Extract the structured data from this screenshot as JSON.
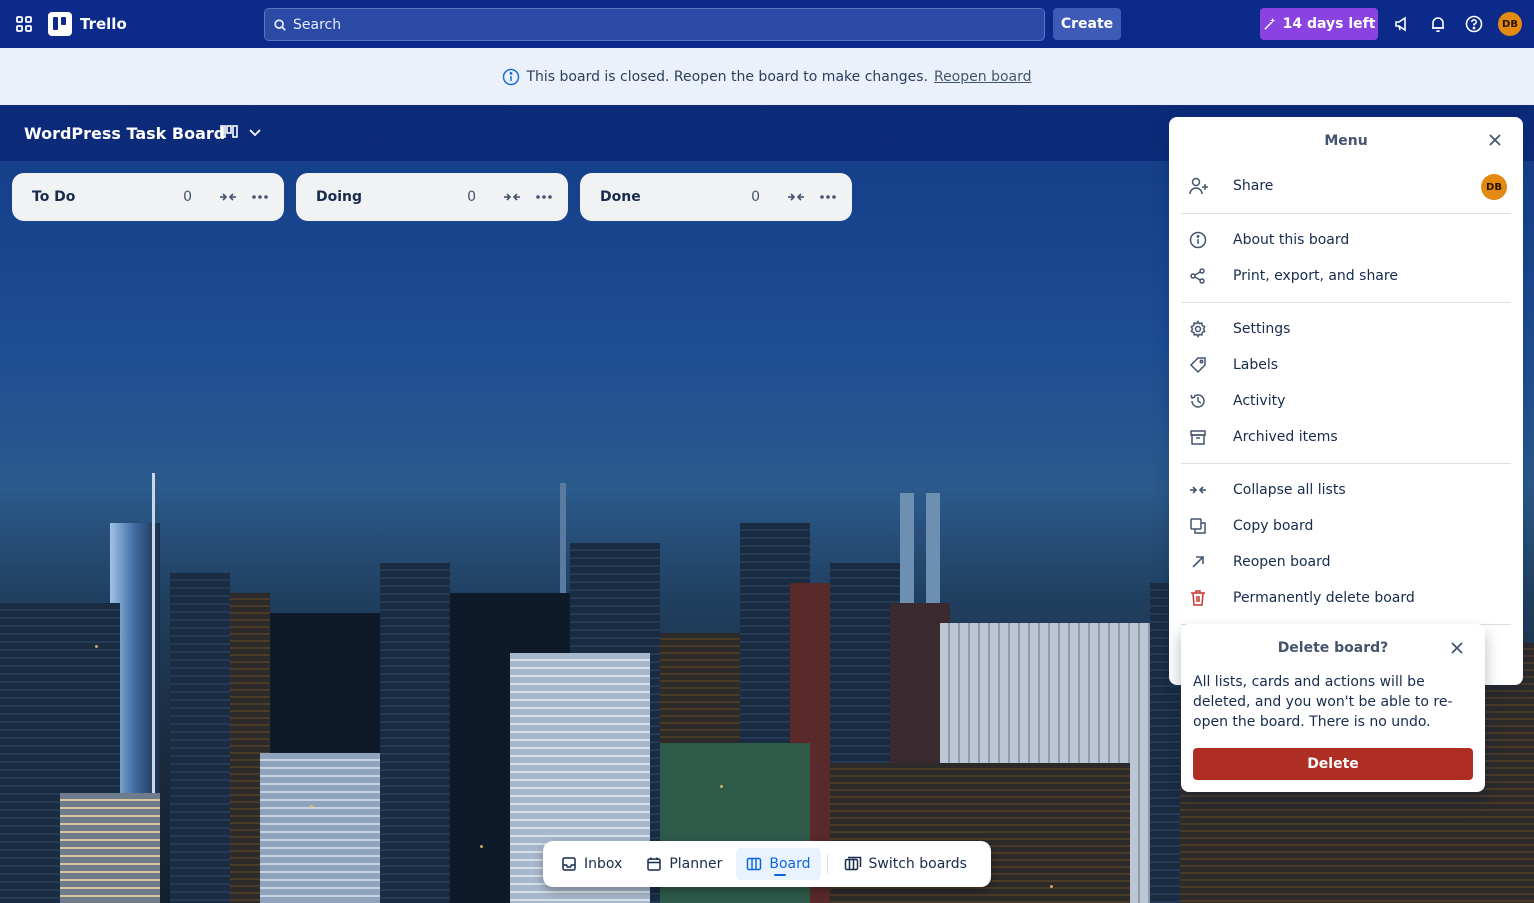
{
  "topbar": {
    "apps_icon": "apps-grid-icon",
    "app_name": "Trello",
    "search_placeholder": "Search",
    "create_label": "Create",
    "trial_label": "14 days left",
    "icons": [
      "megaphone-icon",
      "bell-icon",
      "help-icon"
    ],
    "user_initials": "DB"
  },
  "banner": {
    "message": "This board is closed. Reopen the board to make changes.",
    "link": "Reopen board"
  },
  "board": {
    "title": "WordPress Task Board",
    "lists": [
      {
        "name": "To Do",
        "count": "0"
      },
      {
        "name": "Doing",
        "count": "0"
      },
      {
        "name": "Done",
        "count": "0"
      }
    ]
  },
  "menu": {
    "title": "Menu",
    "share_label": "Share",
    "share_avatar": "DB",
    "items_group1": [
      "About this board",
      "Print, export, and share"
    ],
    "items_group2": [
      "Settings",
      "Labels",
      "Activity",
      "Archived items"
    ],
    "items_group3": [
      "Collapse all lists",
      "Copy board",
      "Reopen board",
      "Permanently delete board"
    ]
  },
  "delete_popover": {
    "title": "Delete board?",
    "body": "All lists, cards and actions will be deleted, and you won't be able to re-open the board. There is no undo.",
    "button": "Delete"
  },
  "bottom_nav": {
    "items": [
      "Inbox",
      "Planner",
      "Board",
      "Switch boards"
    ],
    "active": "Board"
  },
  "colors": {
    "topbar": "#0b2a8a",
    "trial": "#8a43e0",
    "delete": "#ae2e24",
    "avatar": "#e38a12"
  }
}
